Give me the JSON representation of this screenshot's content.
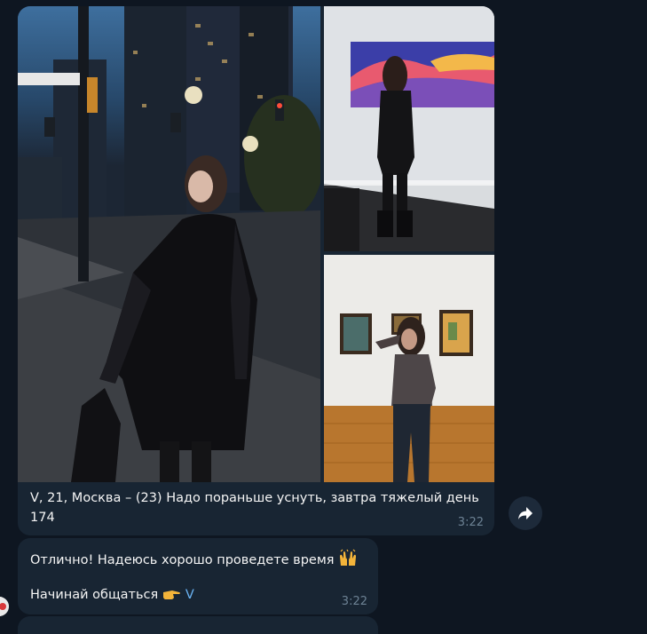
{
  "album_message": {
    "caption_line1": "V, 21, Москва – (23) Надо пораньше уснуть, завтра тяжелый день",
    "caption_line2": "174",
    "time": "3:22"
  },
  "reply_message": {
    "text": "Отлично! Надеюсь хорошо проведете время",
    "emoji_hands": "raised-hands",
    "prompt": "Начинай общаться",
    "emoji_point": "pointing-right",
    "mention": "V",
    "time": "3:22"
  },
  "icons": {
    "forward": "forward-arrow-icon"
  },
  "colors": {
    "background": "#0e1621",
    "bubble": "#182533",
    "link": "#6ab3f3",
    "timestamp": "#6d8294"
  }
}
